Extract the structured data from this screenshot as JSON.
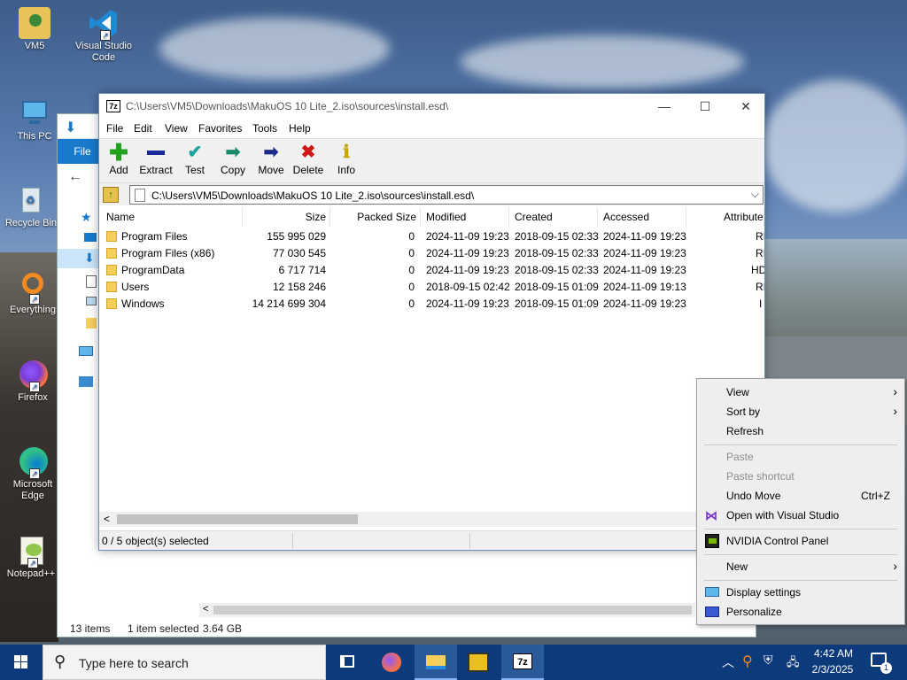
{
  "desktop_icons": [
    {
      "label": "VM5"
    },
    {
      "label": "Visual Studio Code"
    },
    {
      "label": "This PC"
    },
    {
      "label": "Recycle Bin"
    },
    {
      "label": "Everything"
    },
    {
      "label": "Firefox"
    },
    {
      "label": "Microsoft Edge"
    },
    {
      "label": "Notepad++"
    }
  ],
  "explorer": {
    "file_tab": "File",
    "status_items": "13 items",
    "status_selected": "1 item selected",
    "status_size": "3.64 GB"
  },
  "zip": {
    "logo": "7z",
    "title": "C:\\Users\\VM5\\Downloads\\MakuOS 10 Lite_2.iso\\sources\\install.esd\\",
    "menu": [
      "File",
      "Edit",
      "View",
      "Favorites",
      "Tools",
      "Help"
    ],
    "toolbar": [
      "Add",
      "Extract",
      "Test",
      "Copy",
      "Move",
      "Delete",
      "Info"
    ],
    "address": "C:\\Users\\VM5\\Downloads\\MakuOS 10 Lite_2.iso\\sources\\install.esd\\",
    "columns": [
      "Name",
      "Size",
      "Packed Size",
      "Modified",
      "Created",
      "Accessed",
      "Attributes"
    ],
    "rows": [
      {
        "name": "Program Files",
        "size": "155 995 029",
        "packed": "0",
        "modified": "2024-11-09 19:23",
        "created": "2018-09-15 02:33",
        "accessed": "2024-11-09 19:23",
        "attr": "RI"
      },
      {
        "name": "Program Files (x86)",
        "size": "77 030 545",
        "packed": "0",
        "modified": "2024-11-09 19:23",
        "created": "2018-09-15 02:33",
        "accessed": "2024-11-09 19:23",
        "attr": "RI"
      },
      {
        "name": "ProgramData",
        "size": "6 717 714",
        "packed": "0",
        "modified": "2024-11-09 19:23",
        "created": "2018-09-15 02:33",
        "accessed": "2024-11-09 19:23",
        "attr": "HD"
      },
      {
        "name": "Users",
        "size": "12 158 246",
        "packed": "0",
        "modified": "2018-09-15 02:42",
        "created": "2018-09-15 01:09",
        "accessed": "2024-11-09 19:13",
        "attr": "RI"
      },
      {
        "name": "Windows",
        "size": "14 214 699 304",
        "packed": "0",
        "modified": "2024-11-09 19:23",
        "created": "2018-09-15 01:09",
        "accessed": "2024-11-09 19:23",
        "attr": "I"
      }
    ],
    "status": "0 / 5 object(s) selected"
  },
  "context_menu": {
    "view": "View",
    "sort_by": "Sort by",
    "refresh": "Refresh",
    "paste": "Paste",
    "paste_shortcut": "Paste shortcut",
    "undo_move": "Undo Move",
    "undo_shortcut": "Ctrl+Z",
    "open_vs": "Open with Visual Studio",
    "nvidia": "NVIDIA Control Panel",
    "new": "New",
    "display_settings": "Display settings",
    "personalize": "Personalize"
  },
  "taskbar": {
    "search_placeholder": "Type here to search",
    "time": "4:42 AM",
    "date": "2/3/2025",
    "notification_count": "1"
  }
}
